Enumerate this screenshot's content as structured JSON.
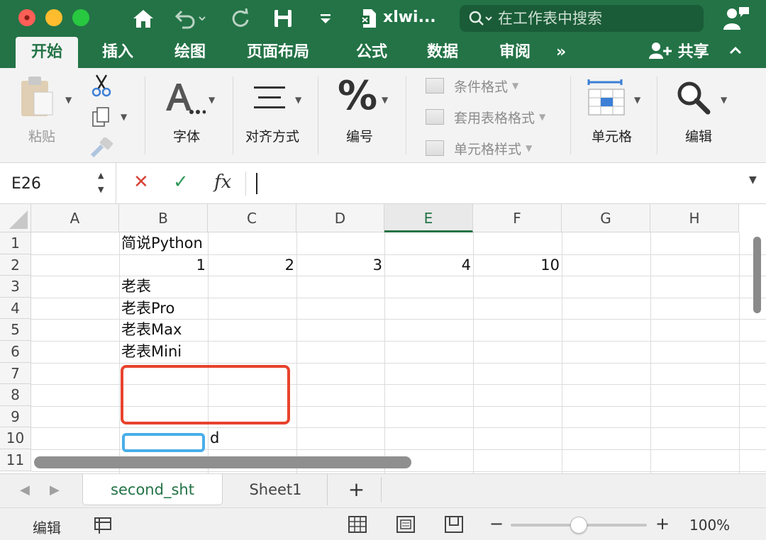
{
  "window": {
    "title": "xlwi...",
    "search_placeholder": "在工作表中搜索"
  },
  "tabs": [
    {
      "label": "开始",
      "active": true
    },
    {
      "label": "插入"
    },
    {
      "label": "绘图"
    },
    {
      "label": "页面布局"
    },
    {
      "label": "公式"
    },
    {
      "label": "数据"
    },
    {
      "label": "审阅"
    },
    {
      "label": "»"
    }
  ],
  "share_label": "共享",
  "ribbon": {
    "paste_label": "粘贴",
    "font_label": "字体",
    "align_label": "对齐方式",
    "number_label": "编号",
    "styles": [
      "条件格式",
      "套用表格格式",
      "单元格样式"
    ],
    "cells_label": "单元格",
    "edit_label": "编辑"
  },
  "formula_bar": {
    "name_box": "E26",
    "fx": "fx",
    "value": ""
  },
  "columns": [
    "A",
    "B",
    "C",
    "D",
    "E",
    "F",
    "G",
    "H"
  ],
  "selected_column": "E",
  "rows": [
    "1",
    "2",
    "3",
    "4",
    "5",
    "6",
    "7",
    "8",
    "9",
    "10",
    "11"
  ],
  "cells": {
    "B1": "简说Python",
    "B2": "1",
    "C2": "2",
    "D2": "3",
    "E2": "4",
    "F2": "10",
    "B3": "老表",
    "B4": "老表Pro",
    "B5": "老表Max",
    "B6": "老表Mini",
    "C10": "d"
  },
  "sheets": [
    {
      "name": "second_sht",
      "active": true
    },
    {
      "name": "Sheet1"
    }
  ],
  "status": {
    "mode": "编辑",
    "zoom": "100%"
  },
  "colors": {
    "brand": "#237346",
    "highlight_red": "#e8432d",
    "highlight_blue": "#49aee9"
  }
}
